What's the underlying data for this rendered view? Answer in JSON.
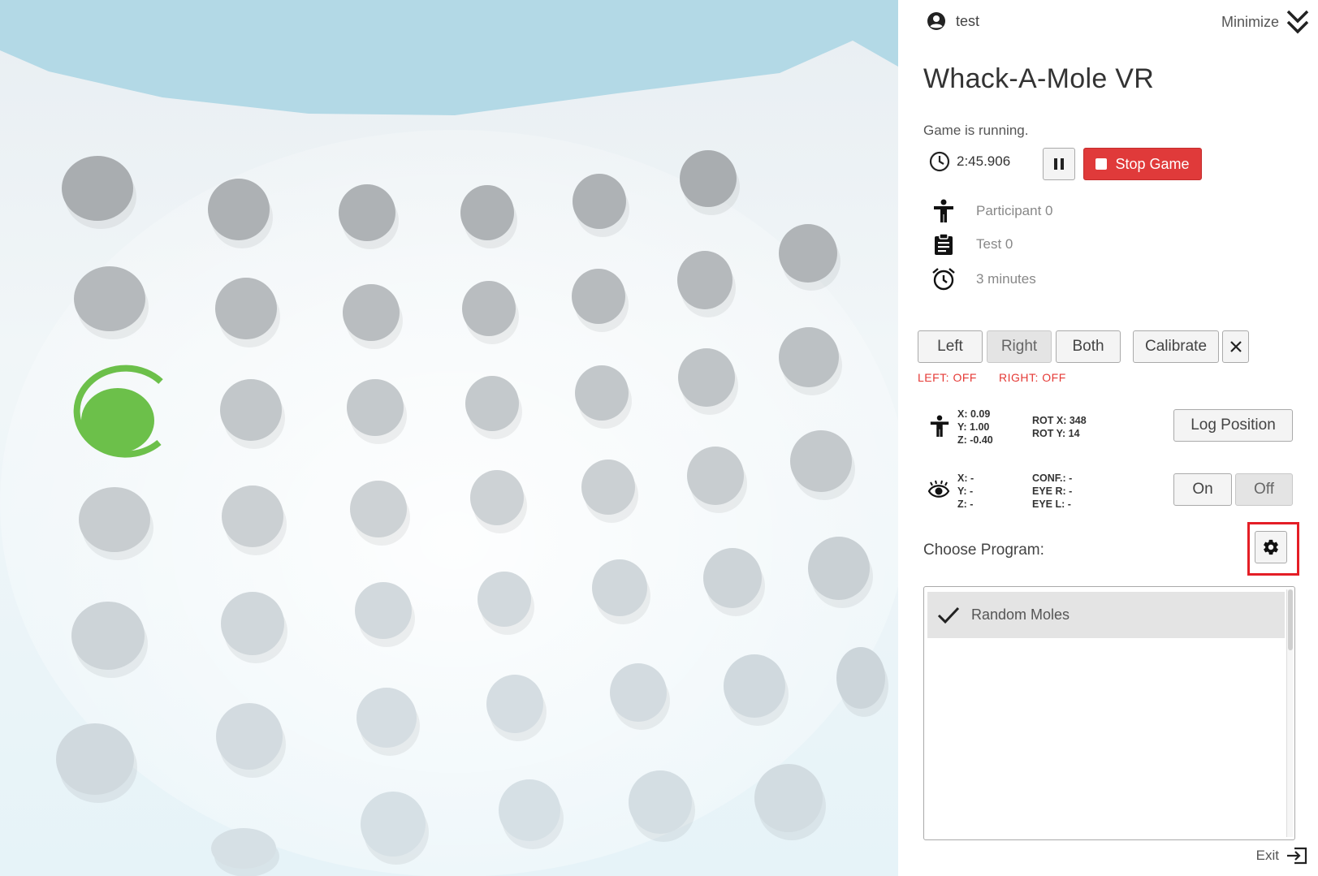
{
  "header": {
    "user_name": "test",
    "minimize_label": "Minimize"
  },
  "title": "Whack-A-Mole VR",
  "game": {
    "status": "Game is running.",
    "timer": "2:45.906",
    "stop_label": "Stop Game"
  },
  "session": {
    "participant": "Participant 0",
    "test": "Test 0",
    "duration": "3 minutes"
  },
  "controllers": {
    "left_label": "Left",
    "right_label": "Right",
    "both_label": "Both",
    "calibrate_label": "Calibrate",
    "left_status": "LEFT: OFF",
    "right_status": "RIGHT: OFF",
    "active_hand": "Right"
  },
  "head_position": {
    "x": "X: 0.09",
    "y": "Y: 1.00",
    "z": "Z: -0.40",
    "rot_x": "ROT X: 348",
    "rot_y": "ROT Y: 14",
    "log_label": "Log Position"
  },
  "eye_tracking": {
    "x": "X: -",
    "y": "Y: -",
    "z": "Z: -",
    "conf": "CONF.: -",
    "eye_r": "EYE R: -",
    "eye_l": "EYE L: -",
    "on_label": "On",
    "off_label": "Off",
    "active": "Off"
  },
  "program": {
    "label": "Choose Program:",
    "items": [
      {
        "name": "Random Moles",
        "selected": true
      }
    ]
  },
  "footer": {
    "exit_label": "Exit"
  },
  "colors": {
    "stop_button": "#e03a3a",
    "status_off": "#e53935",
    "active_mole": "#6cc04a",
    "highlight_frame": "#e41e26",
    "sky": "#b3d9e6"
  },
  "icons": {
    "user": "account-circle-icon",
    "minimize": "double-chevron-down-icon",
    "timer": "clock-icon",
    "pause": "pause-icon",
    "stop": "stop-icon",
    "participant": "person-icon",
    "test": "clipboard-icon",
    "duration": "alarm-icon",
    "controller": "hammer-icon",
    "head": "person-icon",
    "eye": "eye-icon",
    "settings": "gear-icon",
    "selected": "check-icon",
    "exit": "exit-icon"
  }
}
